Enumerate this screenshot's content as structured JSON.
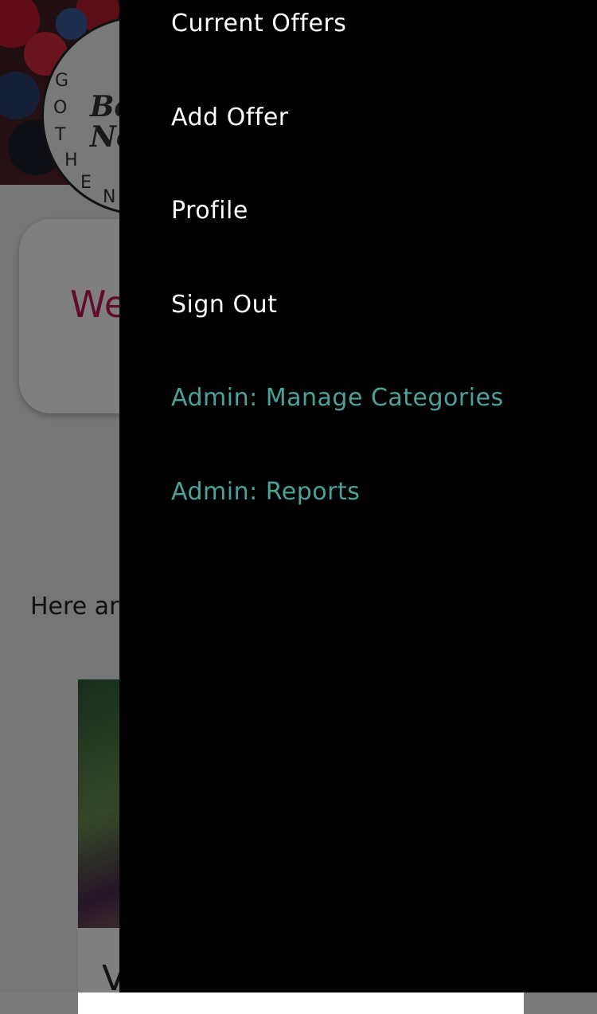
{
  "background_page": {
    "logo": {
      "text_line1": "Be",
      "text_line2": "Ne",
      "ring_letters": [
        "G",
        "O",
        "T",
        "H",
        "E",
        "N"
      ]
    },
    "welcome_title": "We",
    "intro_text": "Here ar",
    "offer_title": "V"
  },
  "drawer": {
    "items": [
      {
        "label": "Current Offers",
        "admin": false
      },
      {
        "label": "Add Offer",
        "admin": false
      },
      {
        "label": "Profile",
        "admin": false
      },
      {
        "label": "Sign Out",
        "admin": false
      },
      {
        "label": "Admin: Manage Categories",
        "admin": true
      },
      {
        "label": "Admin: Reports",
        "admin": true
      }
    ]
  },
  "colors": {
    "drawer_background": "#000000",
    "nav_text": "#ffffff",
    "admin_text": "#4aa39a",
    "welcome_accent": "#c2185b"
  }
}
